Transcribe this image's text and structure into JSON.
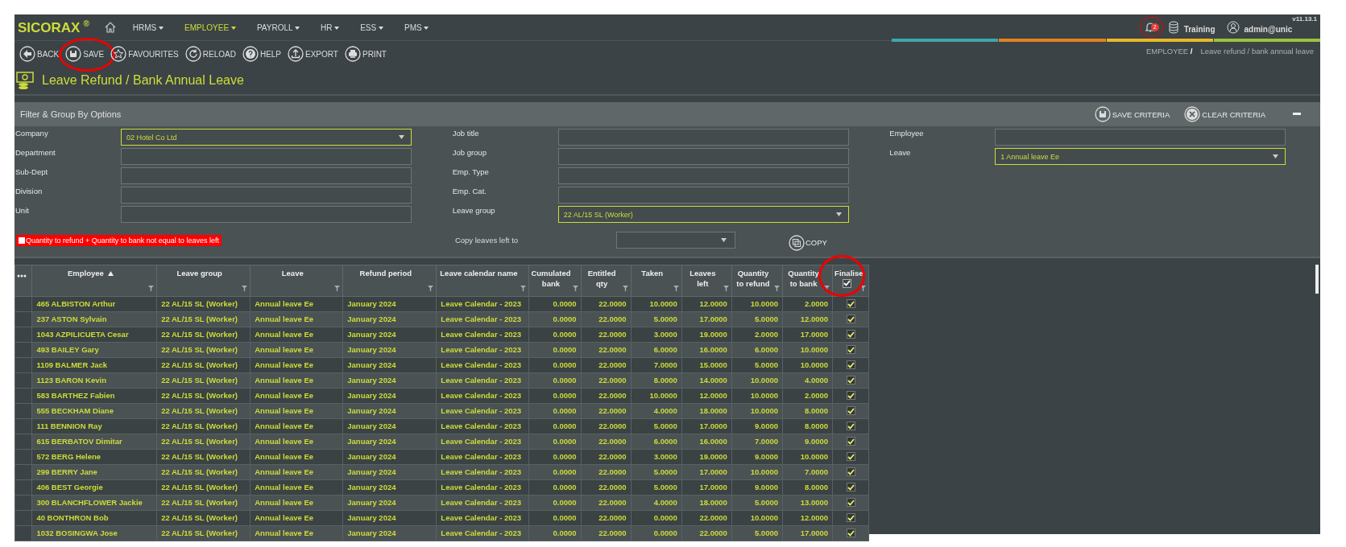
{
  "header": {
    "logo": "SICORAX",
    "logo_mark": "®",
    "menu": [
      {
        "label": "HRMS",
        "selected": false
      },
      {
        "label": "EMPLOYEE",
        "selected": true
      },
      {
        "label": "PAYROLL",
        "selected": false
      },
      {
        "label": "HR",
        "selected": false
      },
      {
        "label": "ESS",
        "selected": false
      },
      {
        "label": "PMS",
        "selected": false
      }
    ],
    "notifications": "2",
    "notifications_circled": true,
    "database": "Training",
    "user": "admin@unic",
    "version": "v11.13.1"
  },
  "toolbar": [
    {
      "kind": "back",
      "label": "BACK",
      "circled": false
    },
    {
      "kind": "save",
      "label": "SAVE",
      "circled": true
    },
    {
      "kind": "favourites",
      "label": "FAVOURITES",
      "circled": false
    },
    {
      "kind": "reload",
      "label": "RELOAD",
      "circled": false
    },
    {
      "kind": "help",
      "label": "HELP",
      "circled": false
    },
    {
      "kind": "export",
      "label": "EXPORT",
      "circled": false
    },
    {
      "kind": "print",
      "label": "PRINT",
      "circled": false
    }
  ],
  "breadcrumb": {
    "section": "EMPLOYEE",
    "separator": "/",
    "page": "Leave refund / bank annual leave"
  },
  "page_title": "Leave Refund / Bank Annual Leave",
  "filter": {
    "title": "Filter & Group By Options",
    "actions": [
      {
        "kind": "save",
        "label": "SAVE CRITERIA"
      },
      {
        "kind": "clear",
        "label": "CLEAR CRITERIA"
      }
    ],
    "columns": [
      [
        {
          "label": "Company",
          "kind": "select",
          "value": "02 Hotel Co Ltd"
        },
        {
          "label": "Department",
          "kind": "text"
        },
        {
          "label": "Sub-Dept",
          "kind": "text"
        },
        {
          "label": "Division",
          "kind": "text"
        },
        {
          "label": "Unit",
          "kind": "text"
        }
      ],
      [
        {
          "label": "Job title",
          "kind": "text"
        },
        {
          "label": "Job group",
          "kind": "text"
        },
        {
          "label": "Emp. Type",
          "kind": "text"
        },
        {
          "label": "Emp. Cat.",
          "kind": "text"
        },
        {
          "label": "Leave group",
          "kind": "select",
          "value": "22 AL/15 SL (Worker)"
        }
      ],
      [
        {
          "label": "Employee",
          "kind": "text"
        },
        {
          "label": "Leave",
          "kind": "select",
          "value": "1 Annual leave Ee"
        }
      ]
    ],
    "mismatch": {
      "label": "Quantity to refund + Quantity to bank not equal to leaves left",
      "checked": false
    },
    "copy": {
      "label": "Copy leaves left to",
      "button": "COPY"
    }
  },
  "table": {
    "columns": [
      {
        "label": "Employee",
        "kind": "text",
        "sorted": true
      },
      {
        "label": "Leave group",
        "kind": "text",
        "sorted": false
      },
      {
        "label": "Leave",
        "kind": "text",
        "sorted": false
      },
      {
        "label": "Refund period",
        "kind": "text",
        "sorted": false
      },
      {
        "label": "Leave calendar name",
        "kind": "text",
        "sorted": false
      },
      {
        "label": "Cumulated bank",
        "kind": "number",
        "sorted": false
      },
      {
        "label": "Entitled qty",
        "kind": "number",
        "sorted": false
      },
      {
        "label": "Taken",
        "kind": "number",
        "sorted": false
      },
      {
        "label": "Leaves left",
        "kind": "number",
        "sorted": false
      },
      {
        "label": "Quantity to refund",
        "kind": "number",
        "sorted": false
      },
      {
        "label": "Quantity to bank",
        "kind": "number",
        "sorted": false
      },
      {
        "label": "Finalise",
        "kind": "check",
        "sorted": false,
        "header_checked": true,
        "circled": true
      }
    ],
    "rows": [
      {
        "cells": [
          "465 ALBISTON Arthur",
          "22 AL/15 SL (Worker)",
          "Annual leave Ee",
          "January 2024",
          "Leave Calendar - 2023",
          "0.0000",
          "22.0000",
          "10.0000",
          "12.0000",
          "10.0000",
          "2.0000"
        ],
        "finalise": true
      },
      {
        "cells": [
          "237 ASTON Sylvain",
          "22 AL/15 SL (Worker)",
          "Annual leave Ee",
          "January 2024",
          "Leave Calendar - 2023",
          "0.0000",
          "22.0000",
          "5.0000",
          "17.0000",
          "5.0000",
          "12.0000"
        ],
        "finalise": true
      },
      {
        "cells": [
          "1043 AZPILICUETA Cesar",
          "22 AL/15 SL (Worker)",
          "Annual leave Ee",
          "January 2024",
          "Leave Calendar - 2023",
          "0.0000",
          "22.0000",
          "3.0000",
          "19.0000",
          "2.0000",
          "17.0000"
        ],
        "finalise": true
      },
      {
        "cells": [
          "493 BAILEY Gary",
          "22 AL/15 SL (Worker)",
          "Annual leave Ee",
          "January 2024",
          "Leave Calendar - 2023",
          "0.0000",
          "22.0000",
          "6.0000",
          "16.0000",
          "6.0000",
          "10.0000"
        ],
        "finalise": true
      },
      {
        "cells": [
          "1109 BALMER Jack",
          "22 AL/15 SL (Worker)",
          "Annual leave Ee",
          "January 2024",
          "Leave Calendar - 2023",
          "0.0000",
          "22.0000",
          "7.0000",
          "15.0000",
          "5.0000",
          "10.0000"
        ],
        "finalise": true
      },
      {
        "cells": [
          "1123 BARON Kevin",
          "22 AL/15 SL (Worker)",
          "Annual leave Ee",
          "January 2024",
          "Leave Calendar - 2023",
          "0.0000",
          "22.0000",
          "8.0000",
          "14.0000",
          "10.0000",
          "4.0000"
        ],
        "finalise": true
      },
      {
        "cells": [
          "583 BARTHEZ Fabien",
          "22 AL/15 SL (Worker)",
          "Annual leave Ee",
          "January 2024",
          "Leave Calendar - 2023",
          "0.0000",
          "22.0000",
          "10.0000",
          "12.0000",
          "10.0000",
          "2.0000"
        ],
        "finalise": true
      },
      {
        "cells": [
          "555 BECKHAM Diane",
          "22 AL/15 SL (Worker)",
          "Annual leave Ee",
          "January 2024",
          "Leave Calendar - 2023",
          "0.0000",
          "22.0000",
          "4.0000",
          "18.0000",
          "10.0000",
          "8.0000"
        ],
        "finalise": true
      },
      {
        "cells": [
          "111 BENNION Ray",
          "22 AL/15 SL (Worker)",
          "Annual leave Ee",
          "January 2024",
          "Leave Calendar - 2023",
          "0.0000",
          "22.0000",
          "5.0000",
          "17.0000",
          "9.0000",
          "8.0000"
        ],
        "finalise": true
      },
      {
        "cells": [
          "615 BERBATOV Dimitar",
          "22 AL/15 SL (Worker)",
          "Annual leave Ee",
          "January 2024",
          "Leave Calendar - 2023",
          "0.0000",
          "22.0000",
          "6.0000",
          "16.0000",
          "7.0000",
          "9.0000"
        ],
        "finalise": true
      },
      {
        "cells": [
          "572 BERG Helene",
          "22 AL/15 SL (Worker)",
          "Annual leave Ee",
          "January 2024",
          "Leave Calendar - 2023",
          "0.0000",
          "22.0000",
          "3.0000",
          "19.0000",
          "9.0000",
          "10.0000"
        ],
        "finalise": true
      },
      {
        "cells": [
          "299 BERRY Jane",
          "22 AL/15 SL (Worker)",
          "Annual leave Ee",
          "January 2024",
          "Leave Calendar - 2023",
          "0.0000",
          "22.0000",
          "5.0000",
          "17.0000",
          "10.0000",
          "7.0000"
        ],
        "finalise": true
      },
      {
        "cells": [
          "406 BEST Georgie",
          "22 AL/15 SL (Worker)",
          "Annual leave Ee",
          "January 2024",
          "Leave Calendar - 2023",
          "0.0000",
          "22.0000",
          "5.0000",
          "17.0000",
          "9.0000",
          "8.0000"
        ],
        "finalise": true
      },
      {
        "cells": [
          "300 BLANCHFLOWER Jackie",
          "22 AL/15 SL (Worker)",
          "Annual leave Ee",
          "January 2024",
          "Leave Calendar - 2023",
          "0.0000",
          "22.0000",
          "4.0000",
          "18.0000",
          "5.0000",
          "13.0000"
        ],
        "finalise": true
      },
      {
        "cells": [
          "40 BONTHRON Bob",
          "22 AL/15 SL (Worker)",
          "Annual leave Ee",
          "January 2024",
          "Leave Calendar - 2023",
          "0.0000",
          "22.0000",
          "0.0000",
          "22.0000",
          "10.0000",
          "12.0000"
        ],
        "finalise": true
      },
      {
        "cells": [
          "1032 BOSINGWA Jose",
          "22 AL/15 SL (Worker)",
          "Annual leave Ee",
          "January 2024",
          "Leave Calendar - 2023",
          "0.0000",
          "22.0000",
          "0.0000",
          "22.0000",
          "5.0000",
          "17.0000"
        ],
        "finalise": true
      }
    ]
  }
}
